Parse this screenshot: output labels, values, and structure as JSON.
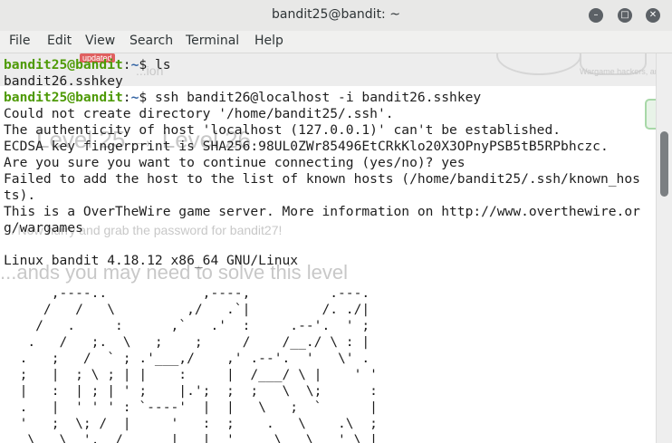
{
  "window": {
    "title": "bandit25@bandit: ~"
  },
  "menu": [
    "File",
    "Edit",
    "View",
    "Search",
    "Terminal",
    "Help"
  ],
  "ghost": {
    "badge": "updated",
    "subtitle": "...ion",
    "level": "Level 25 → Level 26",
    "hint": "... Now hurry and grab the password for bandit27!",
    "cmds": "...ands you may need to solve this level",
    "logo_text": "Wargame hackers, and"
  },
  "terminal": {
    "lines": [
      {
        "prompt_user": "bandit25@bandit",
        "prompt_path": "~",
        "cmd": "ls"
      },
      {
        "text": "bandit26.sshkey"
      },
      {
        "prompt_user": "bandit25@bandit",
        "prompt_path": "~",
        "cmd": "ssh bandit26@localhost -i bandit26.sshkey"
      },
      {
        "text": "Could not create directory '/home/bandit25/.ssh'."
      },
      {
        "text": "The authenticity of host 'localhost (127.0.0.1)' can't be established."
      },
      {
        "text": "ECDSA key fingerprint is SHA256:98UL0ZWr85496EtCRkKlo20X3OPnyPSB5tB5RPbhczc."
      },
      {
        "text": "Are you sure you want to continue connecting (yes/no)? yes"
      },
      {
        "text": "Failed to add the host to the list of known hosts (/home/bandit25/.ssh/known_hos"
      },
      {
        "text": "ts)."
      },
      {
        "text": "This is a OverTheWire game server. More information on http://www.overthewire.or"
      },
      {
        "text": "g/wargames"
      },
      {
        "text": ""
      },
      {
        "text": "Linux bandit 4.18.12 x86_64 GNU/Linux"
      },
      {
        "text": ""
      },
      {
        "text": "      ,----..            ,----,          .---."
      },
      {
        "text": "     /   /   \\         ,/   .`|         /. ./|"
      },
      {
        "text": "    /   .     :      ,`   .'  :     .--'.  ' ;"
      },
      {
        "text": "   .   /   ;.  \\   ;    ;     /    /__./ \\ : |"
      },
      {
        "text": "  .   ;   /  ` ; .'___,/    ,' .--'.  '   \\' ."
      },
      {
        "text": "  ;   |  ; \\ ; | |    :     |  /___/ \\ |    ' '"
      },
      {
        "text": "  |   :  | ; | ' ;    |.';  ;  ;   \\  \\;      :"
      },
      {
        "text": "  .   |  ' ' ' : `----'  |  |   \\   ;  `      |"
      },
      {
        "text": "  '   ;  \\; /  |     '   :  ;    .   \\    .\\  ;"
      },
      {
        "text": "   \\   \\  ',  /      |   |  '     \\   \\   ' \\ |"
      }
    ]
  }
}
